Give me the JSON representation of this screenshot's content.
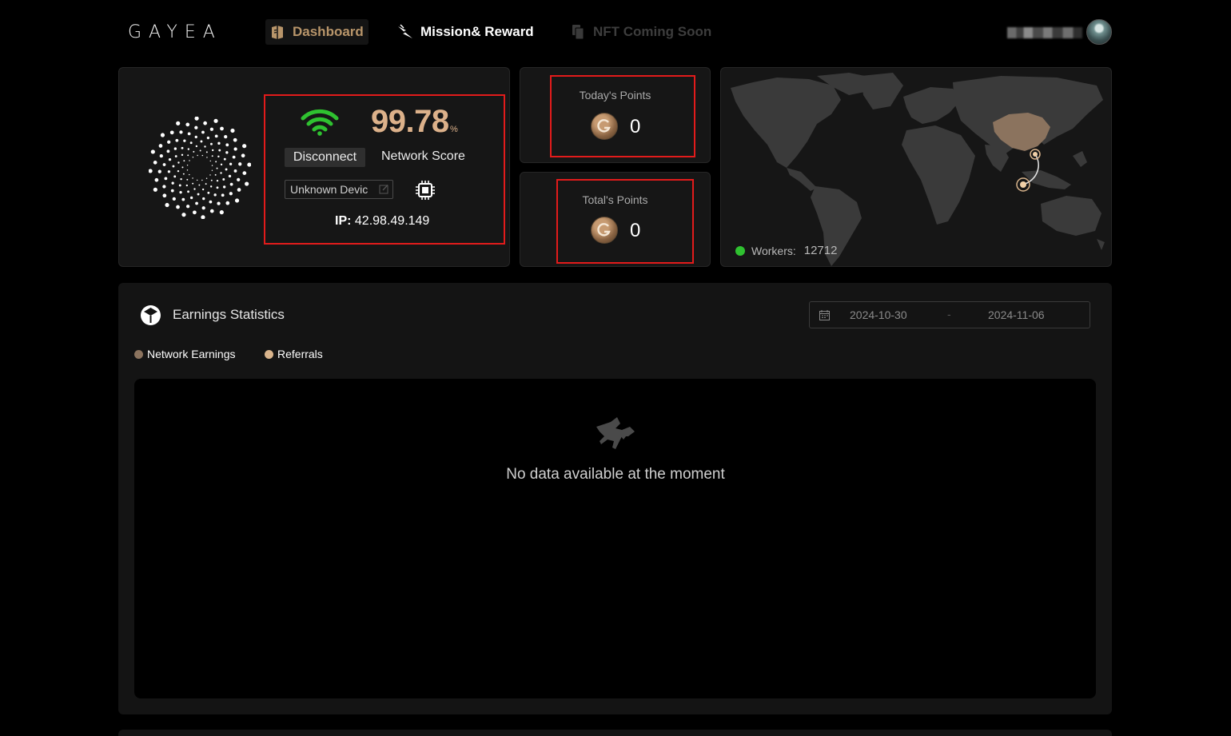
{
  "header": {
    "logo_text": "GAYEA",
    "nav": [
      {
        "label": "Dashboard",
        "icon": "cube-book-icon"
      },
      {
        "label": "Mission& Reward",
        "icon": "bolt-icon"
      },
      {
        "label": "NFT Coming Soon",
        "icon": "copy-icon"
      }
    ]
  },
  "device": {
    "score": "99.78",
    "score_unit": "%",
    "disconnect_label": "Disconnect",
    "network_score_label": "Network Score",
    "device_name": "Unknown Devic",
    "ip_label": "IP:",
    "ip_value": "42.98.49.149"
  },
  "points": {
    "today_label": "Today's Points",
    "today_value": "0",
    "total_label": "Total's Points",
    "total_value": "0"
  },
  "map": {
    "workers_label": "Workers:",
    "workers_count": "12712"
  },
  "earnings": {
    "title": "Earnings Statistics",
    "date_start": "2024-10-30",
    "date_sep": "-",
    "date_end": "2024-11-06",
    "legend": [
      {
        "label": "Network Earnings",
        "color": "#8b735e"
      },
      {
        "label": "Referrals",
        "color": "#d9b48c"
      }
    ],
    "empty_text": "No data available at the moment"
  },
  "colors": {
    "accent": "#dcb18a",
    "highlight_box": "#e21b1b",
    "wifi_green": "#2fc130"
  }
}
